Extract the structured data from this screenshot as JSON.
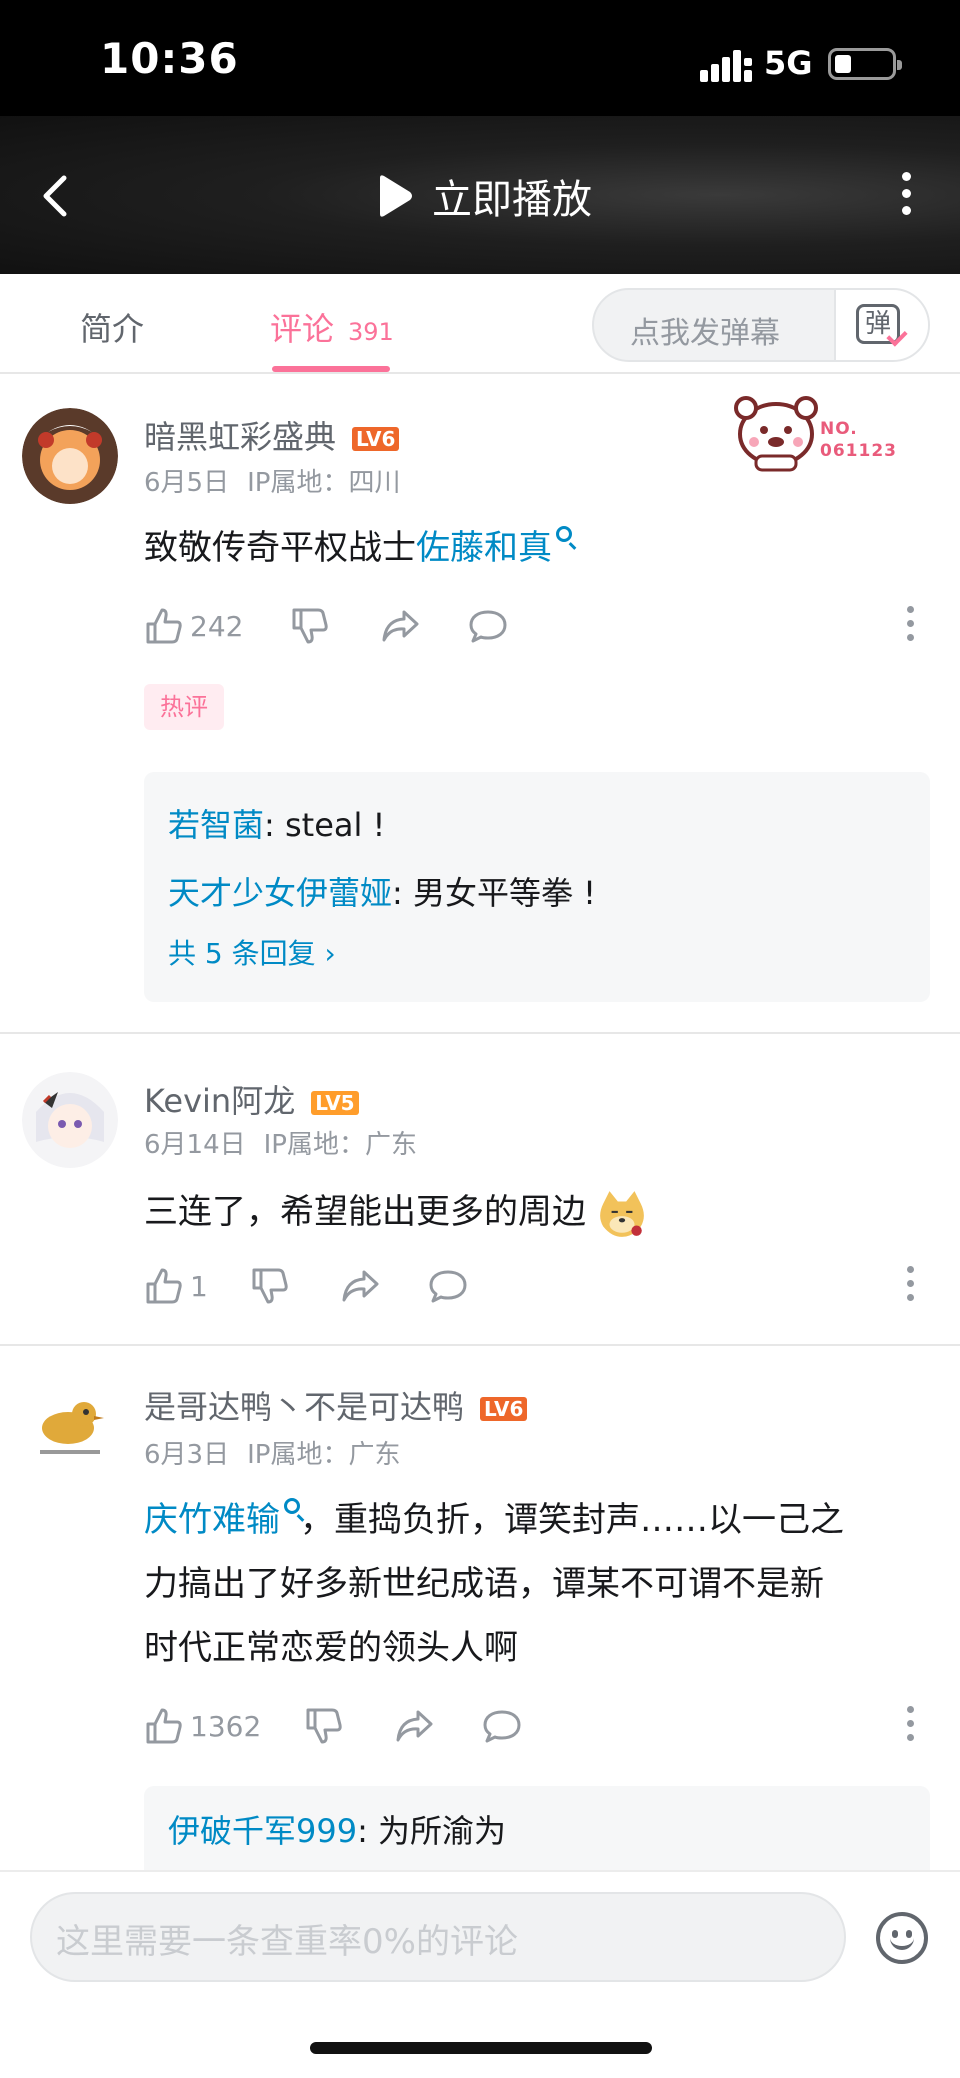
{
  "status_bar": {
    "time": "10:36",
    "network": "5G",
    "battery_percent": 25
  },
  "header": {
    "play_label": "立即播放"
  },
  "tabs": {
    "intro_label": "简介",
    "comments_label": "评论",
    "comments_count": "391",
    "danmaku_placeholder": "点我发弹幕",
    "danmaku_icon_text": "弹"
  },
  "comments": [
    {
      "username": "暗黑虹彩盛典",
      "level": "LV6",
      "date": "6月5日",
      "ip": "IP属地：四川",
      "badge_no": "NO.",
      "badge_num": "061123",
      "text_plain": "致敬传奇平权战士",
      "text_link": "佐藤和真",
      "likes": "242",
      "hot_tag": "热评",
      "replies": [
        {
          "user": "若智菌",
          "text": ": steal !"
        },
        {
          "user": "天才少女伊蕾娅",
          "text": ": 男女平等拳 !"
        }
      ],
      "more_replies": "共 5 条回复"
    },
    {
      "username": "Kevin阿龙",
      "level": "LV5",
      "date": "6月14日",
      "ip": "IP属地：广东",
      "text_plain": "三连了，希望能出更多的周边",
      "likes": "1"
    },
    {
      "username": "是哥达鸭丶不是可达鸭",
      "level": "LV6",
      "date": "6月3日",
      "ip": "IP属地：广东",
      "text_link": "庆竹难输",
      "text_line1": "，重捣负折，谭笑封声……以一己之",
      "text_line2": "力搞出了好多新世纪成语，谭某不可谓不是新",
      "text_line3": "时代正常恋爱的领头人啊",
      "likes": "1362",
      "replies": [
        {
          "user": "伊破千军999",
          "text": ": 为所渝为"
        }
      ]
    }
  ],
  "bottom": {
    "input_placeholder": "这里需要一条查重率0%的评论"
  },
  "colors": {
    "accent": "#fb7299",
    "link": "#008ac5",
    "lv6": "#ee672a",
    "lv5": "#ff9d2b"
  }
}
